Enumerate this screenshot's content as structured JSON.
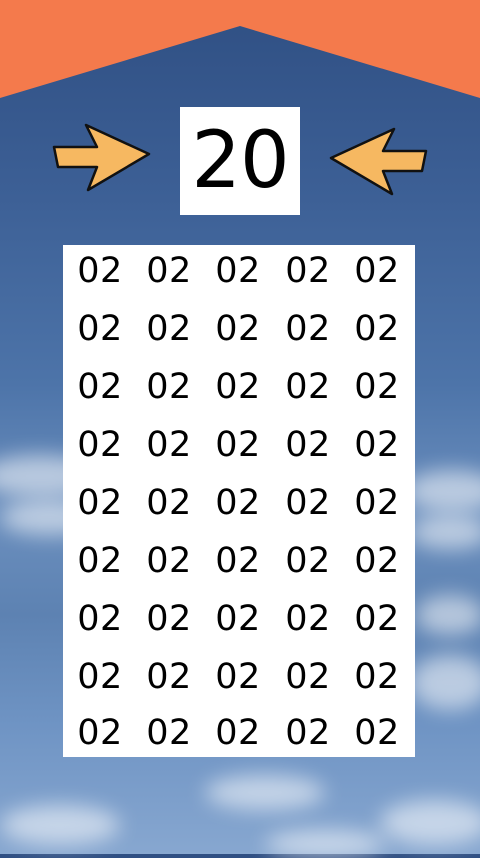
{
  "target_value": "20",
  "colors": {
    "roof": "#f47a4c",
    "arrow_fill": "#f6b861",
    "arrow_stroke": "#111111",
    "panel": "#ffffff",
    "text": "#000000"
  },
  "icons": {
    "left_arrow": "arrow-right-icon",
    "right_arrow": "arrow-left-icon"
  },
  "grid": {
    "rows": [
      [
        "02",
        "02",
        "02",
        "02",
        "02"
      ],
      [
        "02",
        "02",
        "02",
        "02",
        "02"
      ],
      [
        "02",
        "02",
        "02",
        "02",
        "02"
      ],
      [
        "02",
        "02",
        "02",
        "02",
        "02"
      ],
      [
        "02",
        "02",
        "02",
        "02",
        "02"
      ],
      [
        "02",
        "02",
        "02",
        "02",
        "02"
      ],
      [
        "02",
        "02",
        "02",
        "02",
        "02"
      ],
      [
        "02",
        "02",
        "02",
        "02",
        "02"
      ],
      [
        "02",
        "02",
        "02",
        "02",
        "02"
      ]
    ]
  }
}
